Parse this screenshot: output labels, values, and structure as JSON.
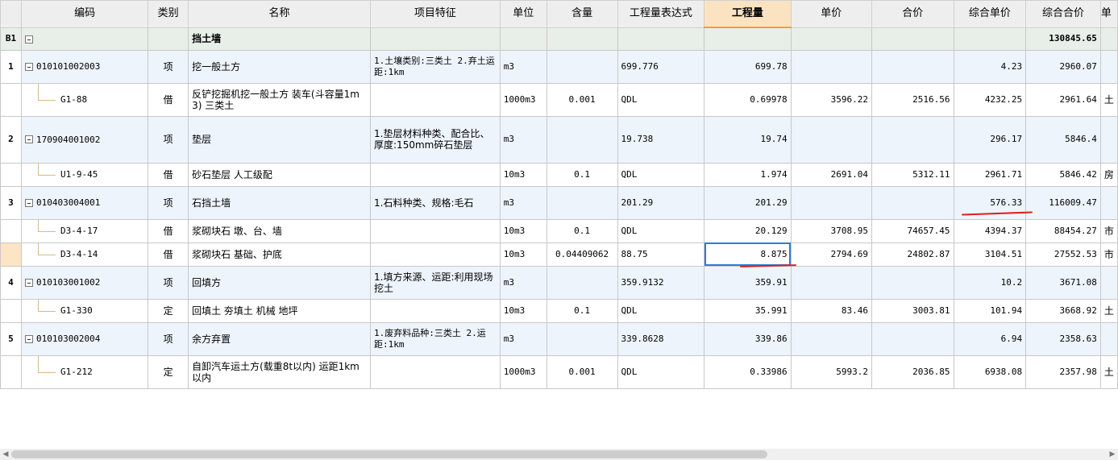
{
  "headers": {
    "col_code": "编码",
    "col_type": "类别",
    "col_name": "名称",
    "col_feature": "项目特征",
    "col_unit": "单位",
    "col_qty_content": "含量",
    "col_expr": "工程量表达式",
    "col_qty": "工程量",
    "col_price": "单价",
    "col_total": "合价",
    "col_unit_price": "综合单价",
    "col_combined_total": "综合合价",
    "col_cut": "单"
  },
  "rows": [
    {
      "num": "B1",
      "code": "",
      "type": "",
      "name": "挡土墙",
      "feature": "",
      "unit": "",
      "content": "",
      "expr": "",
      "qty": "",
      "price": "",
      "total": "",
      "uprice": "",
      "ctotal": "130845.65",
      "extra": ""
    },
    {
      "num": "1",
      "code": "010101002003",
      "type": "项",
      "name": "挖一般土方",
      "feature": "1.土壤类别:三类土\n2.弃土运距:1km",
      "unit": "m3",
      "content": "",
      "expr": "699.776",
      "qty": "699.78",
      "price": "",
      "total": "",
      "uprice": "4.23",
      "ctotal": "2960.07",
      "extra": ""
    },
    {
      "num": "",
      "code": "G1-88",
      "type": "借",
      "name": "反铲挖掘机挖一般土方 装车(斗容量1m3) 三类土",
      "feature": "",
      "unit": "1000m3",
      "content": "0.001",
      "expr": "QDL",
      "qty": "0.69978",
      "price": "3596.22",
      "total": "2516.56",
      "uprice": "4232.25",
      "ctotal": "2961.64",
      "extra": "土"
    },
    {
      "num": "2",
      "code": "170904001002",
      "type": "项",
      "name": "垫层",
      "feature": "1.垫层材料种类、配合比、厚度:150mm碎石垫层",
      "unit": "m3",
      "content": "",
      "expr": "19.738",
      "qty": "19.74",
      "price": "",
      "total": "",
      "uprice": "296.17",
      "ctotal": "5846.4",
      "extra": ""
    },
    {
      "num": "",
      "code": "U1-9-45",
      "type": "借",
      "name": "砂石垫层 人工级配",
      "feature": "",
      "unit": "10m3",
      "content": "0.1",
      "expr": "QDL",
      "qty": "1.974",
      "price": "2691.04",
      "total": "5312.11",
      "uprice": "2961.71",
      "ctotal": "5846.42",
      "extra": "房"
    },
    {
      "num": "3",
      "code": "010403004001",
      "type": "项",
      "name": "石挡土墙",
      "feature": "1.石料种类、规格:毛石",
      "unit": "m3",
      "content": "",
      "expr": "201.29",
      "qty": "201.29",
      "price": "",
      "total": "",
      "uprice": "576.33",
      "ctotal": "116009.47",
      "extra": ""
    },
    {
      "num": "",
      "code": "D3-4-17",
      "type": "借",
      "name": "浆砌块石 墩、台、墙",
      "feature": "",
      "unit": "10m3",
      "content": "0.1",
      "expr": "QDL",
      "qty": "20.129",
      "price": "3708.95",
      "total": "74657.45",
      "uprice": "4394.37",
      "ctotal": "88454.27",
      "extra": "市"
    },
    {
      "num": "",
      "code": "D3-4-14",
      "type": "借",
      "name": "浆砌块石 基础、护底",
      "feature": "",
      "unit": "10m3",
      "content": "0.04409062",
      "expr": "88.75",
      "qty": "8.875",
      "price": "2794.69",
      "total": "24802.87",
      "uprice": "3104.51",
      "ctotal": "27552.53",
      "extra": "市"
    },
    {
      "num": "4",
      "code": "010103001002",
      "type": "项",
      "name": "回填方",
      "feature": "1.填方来源、运距:利用现场挖土",
      "unit": "m3",
      "content": "",
      "expr": "359.9132",
      "qty": "359.91",
      "price": "",
      "total": "",
      "uprice": "10.2",
      "ctotal": "3671.08",
      "extra": ""
    },
    {
      "num": "",
      "code": "G1-330",
      "type": "定",
      "name": "回填土 夯填土 机械 地坪",
      "feature": "",
      "unit": "10m3",
      "content": "0.1",
      "expr": "QDL",
      "qty": "35.991",
      "price": "83.46",
      "total": "3003.81",
      "uprice": "101.94",
      "ctotal": "3668.92",
      "extra": "土"
    },
    {
      "num": "5",
      "code": "010103002004",
      "type": "项",
      "name": "余方弃置",
      "feature": "1.废弃料品种:三类土\n2.运距:1km",
      "unit": "m3",
      "content": "",
      "expr": "339.8628",
      "qty": "339.86",
      "price": "",
      "total": "",
      "uprice": "6.94",
      "ctotal": "2358.63",
      "extra": ""
    },
    {
      "num": "",
      "code": "G1-212",
      "type": "定",
      "name": "自卸汽车运土方(载重8t以内) 运距1km以内",
      "feature": "",
      "unit": "1000m3",
      "content": "0.001",
      "expr": "QDL",
      "qty": "0.33986",
      "price": "5993.2",
      "total": "2036.85",
      "uprice": "6938.08",
      "ctotal": "2357.98",
      "extra": "土"
    }
  ],
  "colors": {
    "active_header": "#fbe3c2",
    "section_bg": "#e8eee8",
    "item_bg": "#eef4fc",
    "selection": "#2f7ad8",
    "annotation": "#e02020"
  }
}
